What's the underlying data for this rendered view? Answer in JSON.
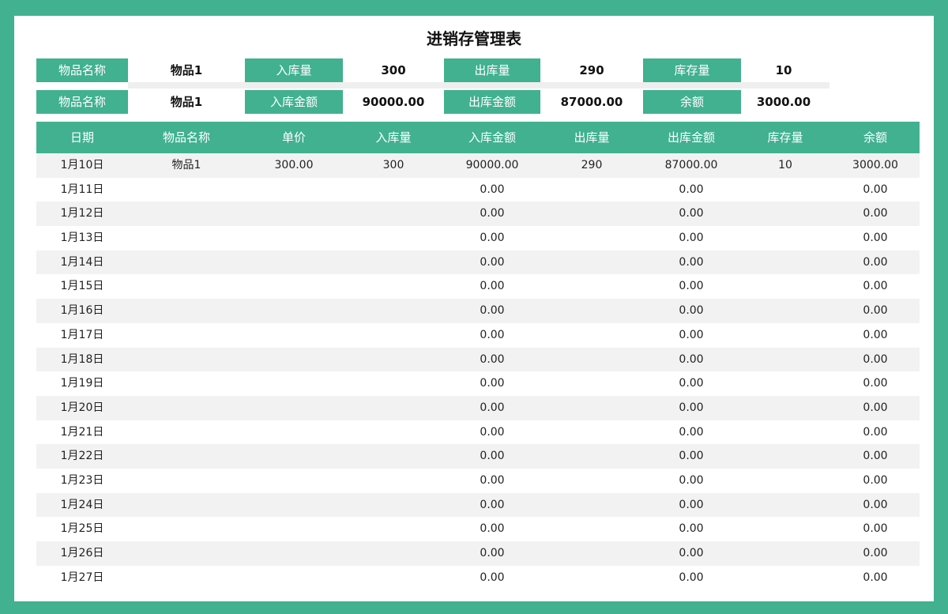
{
  "title": "进销存管理表",
  "summary": {
    "row1": {
      "name_label": "物品名称",
      "name_value": "物品1",
      "in_qty_label": "入库量",
      "in_qty_value": "300",
      "out_qty_label": "出库量",
      "out_qty_value": "290",
      "stock_label": "库存量",
      "stock_value": "10"
    },
    "row2": {
      "name_label": "物品名称",
      "name_value": "物品1",
      "in_amt_label": "入库金额",
      "in_amt_value": "90000.00",
      "out_amt_label": "出库金额",
      "out_amt_value": "87000.00",
      "balance_label": "余额",
      "balance_value": "3000.00"
    }
  },
  "table": {
    "headers": [
      "日期",
      "物品名称",
      "单价",
      "入库量",
      "入库金额",
      "出库量",
      "出库金额",
      "库存量",
      "余额"
    ],
    "rows": [
      [
        "1月10日",
        "物品1",
        "300.00",
        "300",
        "90000.00",
        "290",
        "87000.00",
        "10",
        "3000.00"
      ],
      [
        "1月11日",
        "",
        "",
        "",
        "0.00",
        "",
        "0.00",
        "",
        "0.00"
      ],
      [
        "1月12日",
        "",
        "",
        "",
        "0.00",
        "",
        "0.00",
        "",
        "0.00"
      ],
      [
        "1月13日",
        "",
        "",
        "",
        "0.00",
        "",
        "0.00",
        "",
        "0.00"
      ],
      [
        "1月14日",
        "",
        "",
        "",
        "0.00",
        "",
        "0.00",
        "",
        "0.00"
      ],
      [
        "1月15日",
        "",
        "",
        "",
        "0.00",
        "",
        "0.00",
        "",
        "0.00"
      ],
      [
        "1月16日",
        "",
        "",
        "",
        "0.00",
        "",
        "0.00",
        "",
        "0.00"
      ],
      [
        "1月17日",
        "",
        "",
        "",
        "0.00",
        "",
        "0.00",
        "",
        "0.00"
      ],
      [
        "1月18日",
        "",
        "",
        "",
        "0.00",
        "",
        "0.00",
        "",
        "0.00"
      ],
      [
        "1月19日",
        "",
        "",
        "",
        "0.00",
        "",
        "0.00",
        "",
        "0.00"
      ],
      [
        "1月20日",
        "",
        "",
        "",
        "0.00",
        "",
        "0.00",
        "",
        "0.00"
      ],
      [
        "1月21日",
        "",
        "",
        "",
        "0.00",
        "",
        "0.00",
        "",
        "0.00"
      ],
      [
        "1月22日",
        "",
        "",
        "",
        "0.00",
        "",
        "0.00",
        "",
        "0.00"
      ],
      [
        "1月23日",
        "",
        "",
        "",
        "0.00",
        "",
        "0.00",
        "",
        "0.00"
      ],
      [
        "1月24日",
        "",
        "",
        "",
        "0.00",
        "",
        "0.00",
        "",
        "0.00"
      ],
      [
        "1月25日",
        "",
        "",
        "",
        "0.00",
        "",
        "0.00",
        "",
        "0.00"
      ],
      [
        "1月26日",
        "",
        "",
        "",
        "0.00",
        "",
        "0.00",
        "",
        "0.00"
      ],
      [
        "1月27日",
        "",
        "",
        "",
        "0.00",
        "",
        "0.00",
        "",
        "0.00"
      ]
    ]
  },
  "colors": {
    "accent": "#41b190",
    "stripe": "#f2f2f2"
  }
}
